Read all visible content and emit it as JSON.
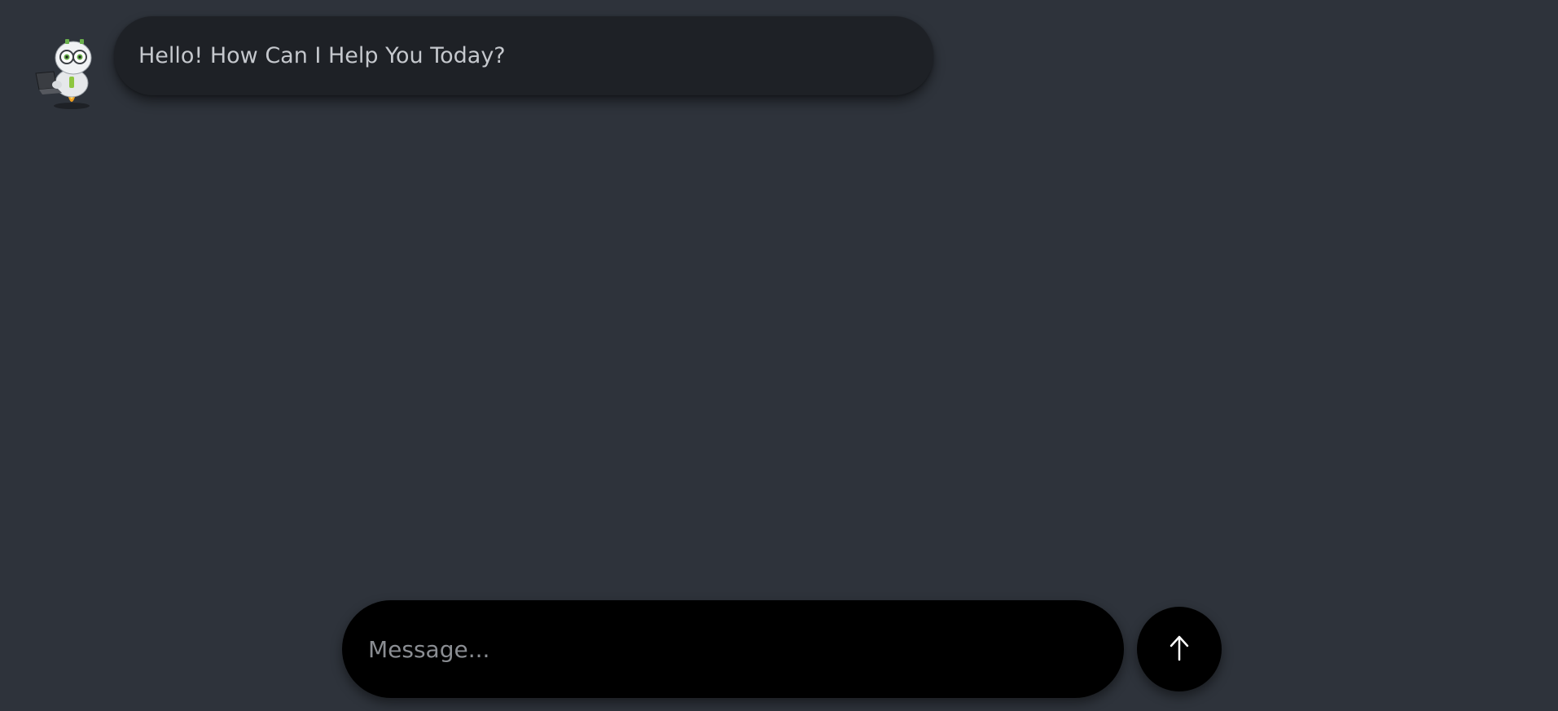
{
  "chat": {
    "messages": [
      {
        "sender": "bot",
        "avatar_icon": "robot-avatar-icon",
        "text": "Hello! How Can I Help You Today?"
      }
    ]
  },
  "composer": {
    "placeholder": "Message...",
    "value": "",
    "send_icon": "arrow-up-icon"
  },
  "colors": {
    "background": "#2e333b",
    "bubble": "#1e2126",
    "bubble_text": "#c5c8cd",
    "input_background": "#000000",
    "placeholder": "#8a8d92"
  }
}
